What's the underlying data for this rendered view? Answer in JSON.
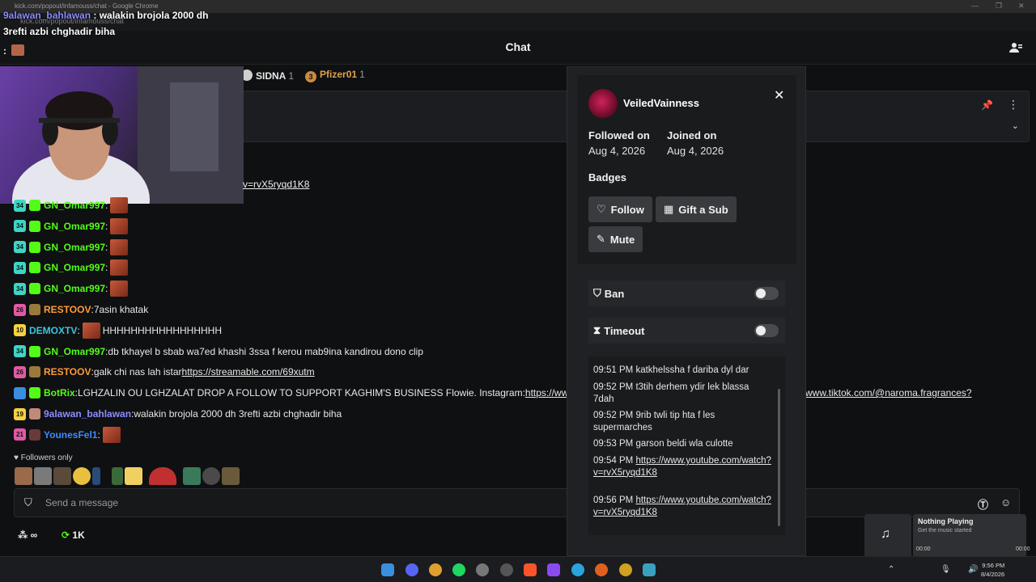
{
  "browser": {
    "window_title": "kick.com/popout/infamouss/chat - Google Chrome",
    "url": "kick.com/popout/infamouss/chat"
  },
  "overlay_messages": [
    {
      "name": "9alawan_bahlawan",
      "text": " : walakin brojola 2000 dh"
    },
    {
      "name": "",
      "text": "3refti azbi chghadir biha"
    },
    {
      "name": "",
      "text": ":"
    }
  ],
  "header": {
    "title": "Chat"
  },
  "leaderboard": [
    {
      "rank": "",
      "name": "SIDNA",
      "count": "1",
      "color": "#e8e8e8"
    },
    {
      "rank": "3",
      "name": "Pfizer01",
      "count": "1",
      "color": "#e0a14a"
    }
  ],
  "pinned_link": "v=rvX5ryqd1K8",
  "messages": [
    {
      "badge": "34",
      "badge_color": "#3cd6c4",
      "sub_color": "#53fc18",
      "user": "GN_Omar997",
      "user_color": "#53fc18",
      "text": "",
      "emote": true
    },
    {
      "badge": "34",
      "badge_color": "#3cd6c4",
      "sub_color": "#53fc18",
      "user": "GN_Omar997",
      "user_color": "#53fc18",
      "text": "",
      "emote": true
    },
    {
      "badge": "34",
      "badge_color": "#3cd6c4",
      "sub_color": "#53fc18",
      "user": "GN_Omar997",
      "user_color": "#53fc18",
      "text": "",
      "emote": true
    },
    {
      "badge": "34",
      "badge_color": "#3cd6c4",
      "sub_color": "#53fc18",
      "user": "GN_Omar997",
      "user_color": "#53fc18",
      "text": "",
      "emote": true
    },
    {
      "badge": "34",
      "badge_color": "#3cd6c4",
      "sub_color": "#53fc18",
      "user": "GN_Omar997",
      "user_color": "#53fc18",
      "text": "",
      "emote": true
    },
    {
      "badge": "26",
      "badge_color": "#e05aa3",
      "sub_color": "#9a7a3a",
      "user": "RESTOOV",
      "user_color": "#ff9a3c",
      "text": " 7asin khatak",
      "emote": false
    },
    {
      "badge": "10",
      "badge_color": "#f5d142",
      "sub_color": "",
      "user": "DEMOXTV",
      "user_color": "#3cc6e0",
      "text": " HHHHHHHHHHHHHHHHH",
      "emote": true
    },
    {
      "badge": "34",
      "badge_color": "#3cd6c4",
      "sub_color": "#53fc18",
      "user": "GN_Omar997",
      "user_color": "#53fc18",
      "text": " db tkhayel b sbab wa7ed khashi 3ssa f kerou mab9ina kandirou dono clip",
      "emote": false
    },
    {
      "badge": "26",
      "badge_color": "#e05aa3",
      "sub_color": "#9a7a3a",
      "user": "RESTOOV",
      "user_color": "#ff9a3c",
      "text": " galk chi nas lah istar ",
      "link": "https://streamable.com/69xutm",
      "emote": false
    },
    {
      "badge": "",
      "badge_color": "#3a8ee0",
      "sub_color": "#53fc18",
      "user": "BotRix",
      "user_color": "#53fc18",
      "text": " LGHZALIN OU LGHZALAT DROP A FOLLOW TO SUPPORT KAGHIM'S BUSINESS Flowie. Instagram: ",
      "link": "https://ww",
      "emote": false
    },
    {
      "badge": "19",
      "badge_color": "#f5d142",
      "sub_color": "#c08a7a",
      "user": "9alawan_bahlawan",
      "user_color": "#8c8cff",
      "text": " walakin brojola 2000 dh 3refti azbi chghadir biha",
      "emote": false
    },
    {
      "badge": "21",
      "badge_color": "#e05aa3",
      "sub_color": "#6a3a3a",
      "user": "YounesFel1",
      "user_color": "#3c8cff",
      "text": "",
      "emote": true
    }
  ],
  "tail_link": "www.tiktok.com/@naroma.fragrances?",
  "followers_only": "Followers only",
  "composer": {
    "placeholder": "Send a message"
  },
  "stats": {
    "viewers_icon_label": "∞",
    "count": "1K"
  },
  "usercard": {
    "username": "VeiledVainness",
    "followed_label": "Followed on",
    "followed_value": "Aug 4, 2026",
    "joined_label": "Joined on",
    "joined_value": "Aug 4, 2026",
    "badges_label": "Badges",
    "follow": "Follow",
    "gift": "Gift a Sub",
    "mute": "Mute",
    "ban": "Ban",
    "timeout": "Timeout",
    "history": [
      {
        "time": "09:51 PM",
        "text": "katkhelssha f dariba dyl dar"
      },
      {
        "time": "09:52 PM",
        "text": "t3tih derhem ydir lek blassa 7dah"
      },
      {
        "time": "09:52 PM",
        "text": "9rib twli tip hta f les supermarches"
      },
      {
        "time": "09:53 PM",
        "text": "garson beldi wla culotte"
      },
      {
        "time": "09:54 PM",
        "link": "https://www.youtube.com/watch?v=rvX5ryqd1K8"
      },
      {
        "time": "09:56 PM",
        "link": "https://www.youtube.com/watch?v=rvX5ryqd1K8"
      }
    ]
  },
  "media": {
    "title": "Nothing Playing",
    "subtitle": "Get the music started",
    "elapsed": "00:00",
    "total": "00:00"
  },
  "clock": {
    "time": "9:56 PM",
    "date": "8/4/2026"
  }
}
